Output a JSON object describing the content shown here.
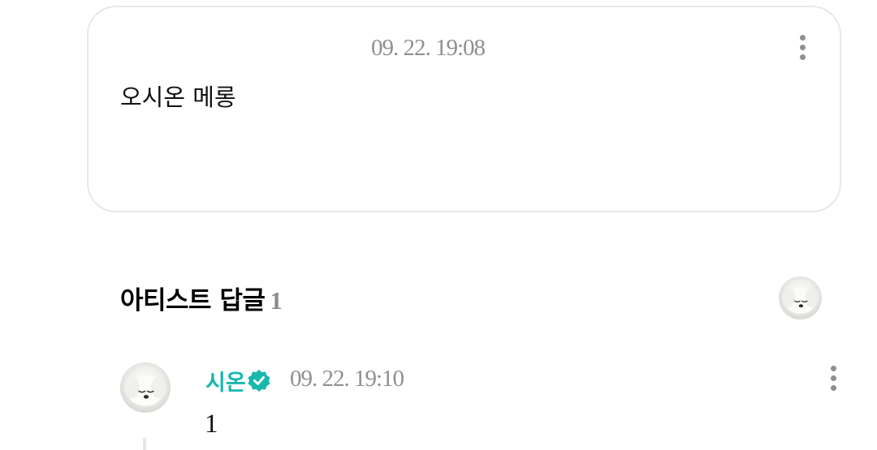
{
  "comment": {
    "timestamp": "09. 22. 19:08",
    "text": "오시온 메롱",
    "more_icon": "more-vertical-icon"
  },
  "artist_replies": {
    "title": "아티스트 답글",
    "count": "1",
    "artist_avatar_icon": "white-dog-avatar"
  },
  "reply": {
    "author": "시온",
    "verified_icon": "verified-badge-icon",
    "verified_color": "#19b7ac",
    "timestamp": "09. 22. 19:10",
    "text": "1",
    "more_icon": "more-vertical-icon"
  }
}
